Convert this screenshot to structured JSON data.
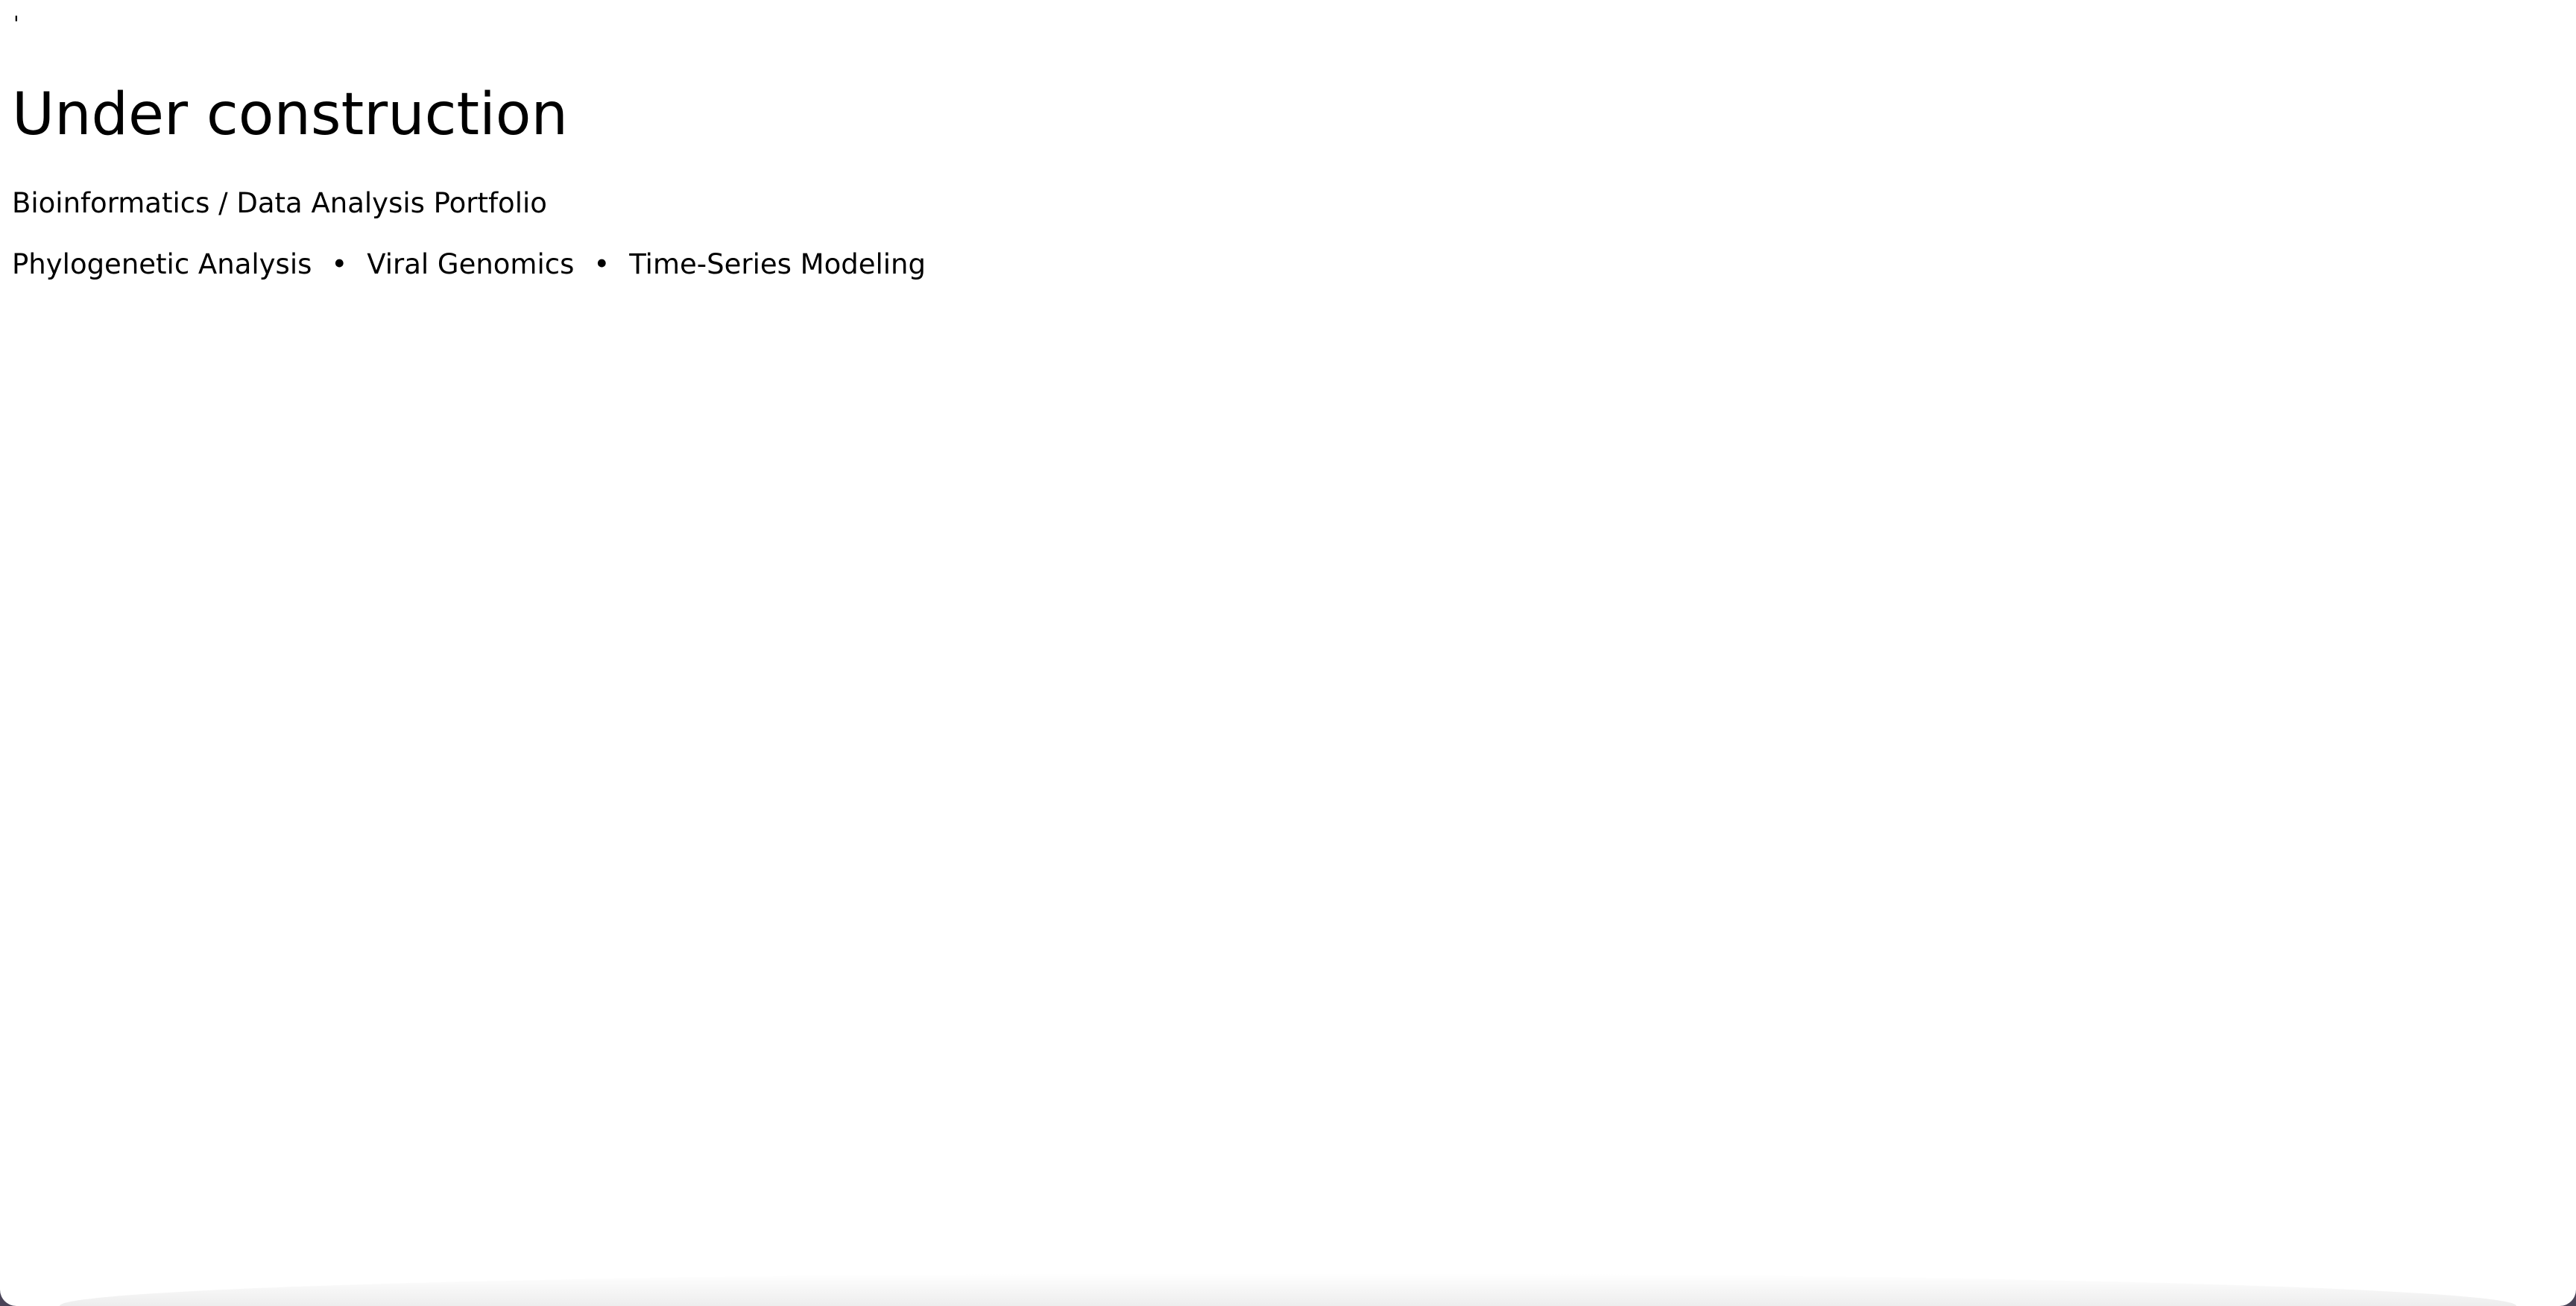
{
  "stray_mark": "'",
  "title": "Under construction",
  "subtitle": "Bioinformatics / Data Analysis Portfolio",
  "topics": [
    "Phylogenetic Analysis",
    "Viral Genomics",
    "Time-Series Modeling"
  ],
  "topic_separator": "•"
}
